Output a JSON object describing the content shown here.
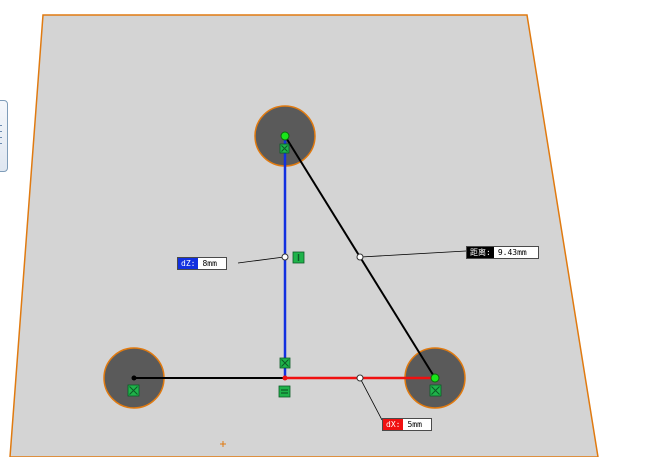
{
  "colors": {
    "plane_fill": "#d4d4d4",
    "plane_edge": "#e07a10",
    "circle_fill": "#5a5a5a",
    "point_green": "#19e619",
    "dz_blue": "#1230e0",
    "dx_red": "#f01010",
    "line_black": "#000000",
    "relation_green": "#1fb34a"
  },
  "icons": {
    "relation_vertical": "vertical-relation-icon",
    "relation_horizontal": "horizontal-relation-icon",
    "relation_coincident": "coincident-relation-icon",
    "origin": "origin-marker-icon"
  },
  "dimensions": {
    "dz": {
      "label": "dZ:",
      "value": "8mm",
      "color": "#1230e0"
    },
    "dx": {
      "label": "dX:",
      "value": "5mm",
      "color": "#f01010"
    },
    "distance": {
      "label": "距离:",
      "value": "9.43mm",
      "color": "#000000"
    }
  }
}
